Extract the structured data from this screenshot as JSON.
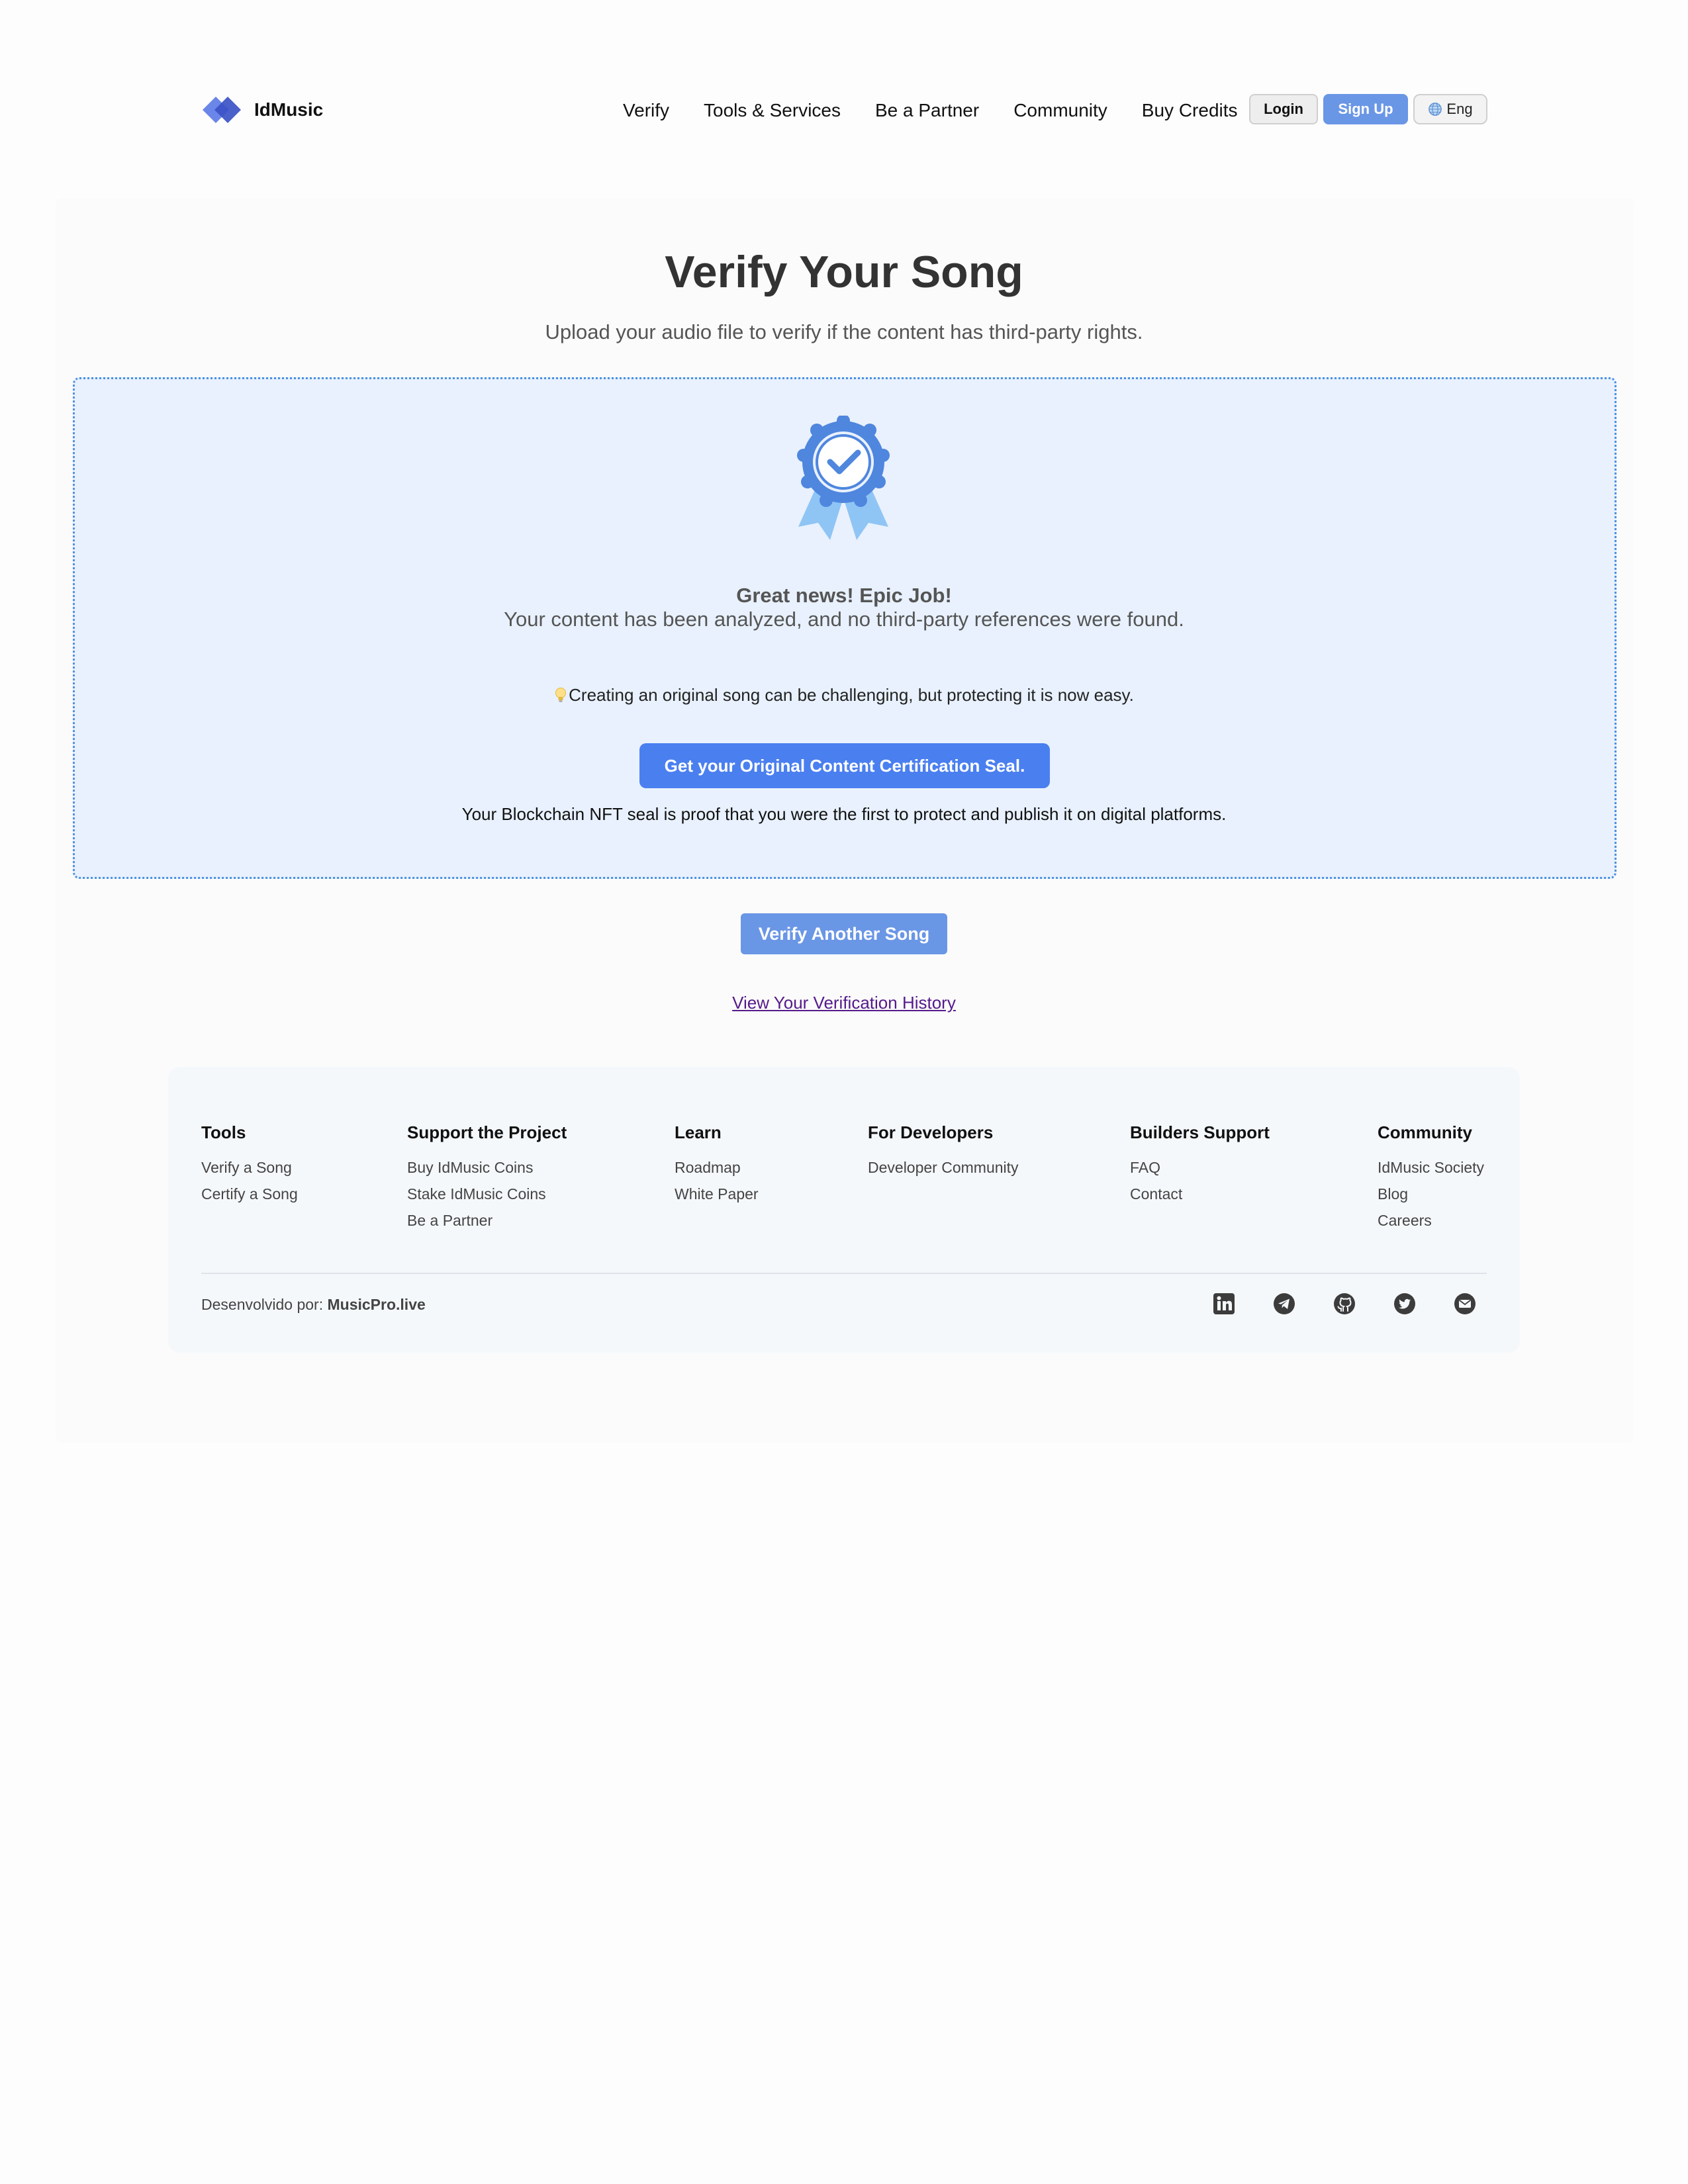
{
  "header": {
    "brand": "IdMusic",
    "nav": [
      "Verify",
      "Tools & Services",
      "Be a Partner",
      "Community",
      "Buy Credits"
    ],
    "login_label": "Login",
    "signup_label": "Sign Up",
    "language_label": "Eng"
  },
  "main": {
    "title": "Verify Your Song",
    "subtitle": "Upload your audio file to verify if the content has third-party rights.",
    "result": {
      "heading": "Great news! Epic Job!",
      "message": "Your content has been analyzed, and no third-party references were found.",
      "tip": "Creating an original song can be challenging, but protecting it is now easy.",
      "cta_label": "Get your Original Content Certification Seal.",
      "nft_note": "Your Blockchain NFT seal is proof that you were the first to protect and publish it on digital platforms."
    },
    "verify_again_label": "Verify Another Song",
    "history_link": "View Your Verification History"
  },
  "footer": {
    "columns": [
      {
        "title": "Tools",
        "links": [
          "Verify a Song",
          "Certify a Song"
        ]
      },
      {
        "title": "Support the Project",
        "links": [
          "Buy IdMusic Coins",
          "Stake IdMusic Coins",
          "Be a Partner"
        ]
      },
      {
        "title": "Learn",
        "links": [
          "Roadmap",
          "White Paper"
        ]
      },
      {
        "title": "For Developers",
        "links": [
          "Developer Community"
        ]
      },
      {
        "title": "Builders Support",
        "links": [
          "FAQ",
          "Contact"
        ]
      },
      {
        "title": "Community",
        "links": [
          "IdMusic Society",
          "Blog",
          "Careers"
        ]
      }
    ],
    "credits_prefix": "Desenvolvido por:",
    "credits_brand": "MusicPro.live",
    "socials": [
      "linkedin-icon",
      "telegram-icon",
      "github-icon",
      "twitter-icon",
      "email-icon"
    ]
  },
  "colors": {
    "accent": "#4a7ff0",
    "button_blue": "#6a96e6",
    "result_bg": "#e8f1fd",
    "result_border": "#4a90e2"
  }
}
